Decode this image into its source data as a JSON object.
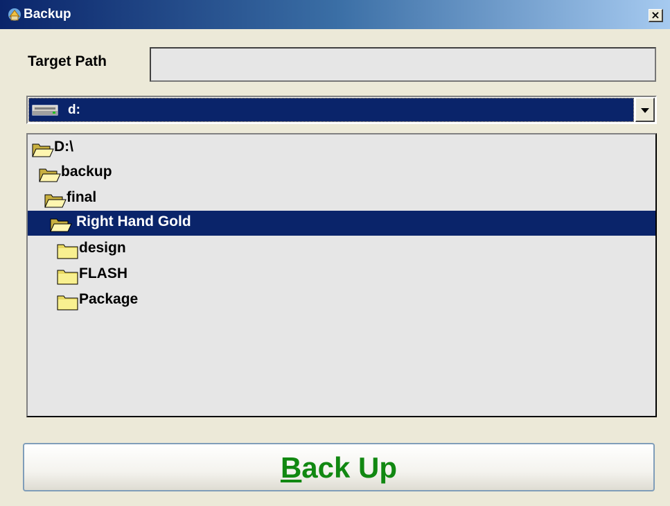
{
  "window": {
    "title": "Backup",
    "close_symbol": "×",
    "icon": "backup-app-icon"
  },
  "target_path": {
    "label": "Target Path",
    "value": ""
  },
  "drive_select": {
    "selected": "d:",
    "icon": "drive-icon"
  },
  "tree": {
    "items": [
      {
        "label": "D:\\",
        "icon": "open-folder-icon",
        "selected": false
      },
      {
        "label": "backup",
        "icon": "open-folder-icon",
        "selected": false
      },
      {
        "label": "final",
        "icon": "open-folder-icon",
        "selected": false
      },
      {
        "label": "Right Hand Gold",
        "icon": "open-folder-icon",
        "selected": true
      },
      {
        "label": "design",
        "icon": "folder-icon",
        "selected": false
      },
      {
        "label": "FLASH",
        "icon": "folder-icon",
        "selected": false
      },
      {
        "label": "Package",
        "icon": "folder-icon",
        "selected": false
      }
    ]
  },
  "backup_button": {
    "mnemonic": "B",
    "rest": "ack Up"
  },
  "colors": {
    "selection": "#0a246a",
    "button_text": "#118811",
    "face": "#ece9d8"
  }
}
